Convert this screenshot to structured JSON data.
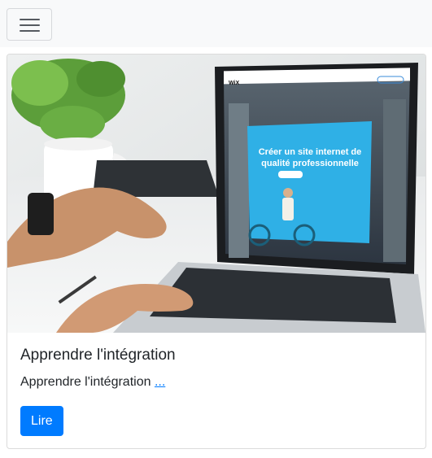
{
  "navbar": {
    "toggler_icon": "hamburger-icon"
  },
  "card": {
    "image": {
      "alt": "Laptop showing a Wix website builder page",
      "screen_headline_line1": "Créer un site internet de",
      "screen_headline_line2": "qualité professionnelle",
      "screen_logo": "WiX"
    },
    "title": "Apprendre l'intégration",
    "text": "Apprendre l'intégration",
    "text_link": "...",
    "button_label": "Lire"
  },
  "colors": {
    "primary": "#007bff",
    "navbar_bg": "#f8f9fa",
    "text": "#212529"
  }
}
